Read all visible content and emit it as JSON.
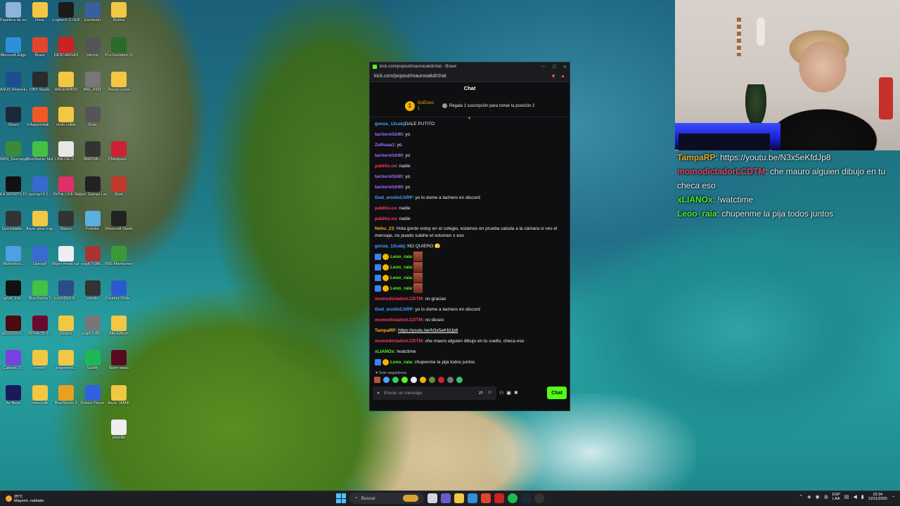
{
  "desktop_icons": [
    {
      "label": "Papelera de reciclaje",
      "color": "#8fb3d9",
      "col": 0,
      "row": 0
    },
    {
      "label": "Drive",
      "color": "#f2c744",
      "col": 1,
      "row": 0
    },
    {
      "label": "Logitech G HUB",
      "color": "#1a1a1a",
      "col": 2,
      "row": 0
    },
    {
      "label": "Escritorio",
      "color": "#3a5fa0",
      "col": 3,
      "row": 0
    },
    {
      "label": "Roblox",
      "color": "#f2c744",
      "col": 4,
      "row": 0
    },
    {
      "label": "Microsoft Edge",
      "color": "#2f8fd8",
      "col": 0,
      "row": 1
    },
    {
      "label": "Brave",
      "color": "#e2452c",
      "col": 1,
      "row": 1
    },
    {
      "label": "DESCARGAS",
      "color": "#cc2222",
      "col": 2,
      "row": 1
    },
    {
      "label": "micros",
      "color": "#555",
      "col": 3,
      "row": 1
    },
    {
      "label": "Pro Evolution Soccer",
      "color": "#2a6a2a",
      "col": 4,
      "row": 1
    },
    {
      "label": "ASUS DriverHub",
      "color": "#1c4f90",
      "col": 0,
      "row": 2
    },
    {
      "label": "OBS Studio",
      "color": "#2a2a2a",
      "col": 1,
      "row": 2
    },
    {
      "label": "ARGENMOD",
      "color": "#f2c744",
      "col": 2,
      "row": 2
    },
    {
      "label": "IMG_8432",
      "color": "#777",
      "col": 3,
      "row": 2
    },
    {
      "label": "Pesos Locos",
      "color": "#f2c744",
      "col": 4,
      "row": 2
    },
    {
      "label": "Steam",
      "color": "#1b2838",
      "col": 0,
      "row": 3
    },
    {
      "label": "EAappinstall...",
      "color": "#f05a22",
      "col": 1,
      "row": 3
    },
    {
      "label": "mofo cuttits",
      "color": "#f2c744",
      "col": 2,
      "row": 3
    },
    {
      "label": "Rust",
      "color": "#555",
      "col": 3,
      "row": 3
    },
    {
      "label": "5809_Descarga",
      "color": "#3a8a3a",
      "col": 0,
      "row": 4
    },
    {
      "label": "BlueStacks Multi-Insta...",
      "color": "#44c044",
      "col": 1,
      "row": 4
    },
    {
      "label": "LINK-DE-D...",
      "color": "#e8e8e8",
      "col": 2,
      "row": 4
    },
    {
      "label": "INNOVA...",
      "color": "#333",
      "col": 3,
      "row": 4
    },
    {
      "label": "CModpack...",
      "color": "#c23",
      "col": 4,
      "row": 4
    },
    {
      "label": "EA SPORTS FC 25",
      "color": "#111",
      "col": 0,
      "row": 5
    },
    {
      "label": "upscayl-2.1...",
      "color": "#3a6ad0",
      "col": 1,
      "row": 5
    },
    {
      "label": "TikTok LIVE Studio",
      "color": "#e0306a",
      "col": 2,
      "row": 5
    },
    {
      "label": "Epic Games Launcher",
      "color": "#222",
      "col": 3,
      "row": 5
    },
    {
      "label": "Rust",
      "color": "#c0392b",
      "col": 4,
      "row": 5
    },
    {
      "label": "EpicInstalle...",
      "color": "#333",
      "col": 0,
      "row": 6
    },
    {
      "label": "flayer para miguel",
      "color": "#f2c744",
      "col": 1,
      "row": 6
    },
    {
      "label": "Banco",
      "color": "#333",
      "col": 2,
      "row": 6
    },
    {
      "label": "Fortnite",
      "color": "#5ab0e0",
      "col": 3,
      "row": 6
    },
    {
      "label": "Minecraft Studio",
      "color": "#222",
      "col": 4,
      "row": 6
    },
    {
      "label": "MisterHors...",
      "color": "#4fa0e0",
      "col": 0,
      "row": 7
    },
    {
      "label": "Upscayl",
      "color": "#3a6ad0",
      "col": 1,
      "row": 7
    },
    {
      "label": "flayer modo carrera",
      "color": "#eee",
      "col": 2,
      "row": 7
    },
    {
      "label": "ezgif-7c9fd...",
      "color": "#a33",
      "col": 3,
      "row": 7
    },
    {
      "label": "MSI Afterburner",
      "color": "#3a9a3a",
      "col": 4,
      "row": 7
    },
    {
      "label": "lghub_inst...",
      "color": "#111",
      "col": 0,
      "row": 8
    },
    {
      "label": "BlueStacks 5",
      "color": "#44c044",
      "col": 1,
      "row": 8
    },
    {
      "label": "bcb2d2e5-8...",
      "color": "#2d4a8a",
      "col": 2,
      "row": 8
    },
    {
      "label": "emote",
      "color": "#333",
      "col": 3,
      "row": 8
    },
    {
      "label": "Counter-Strike 2",
      "color": "#2a5ad0",
      "col": 4,
      "row": 8
    },
    {
      "label": "a6111310-5...",
      "color": "#4a0a10",
      "col": 0,
      "row": 9
    },
    {
      "label": "39704c35-6...",
      "color": "#6a0a30",
      "col": 1,
      "row": 9
    },
    {
      "label": "plugins",
      "color": "#f2c744",
      "col": 2,
      "row": 9
    },
    {
      "label": "ezgif-7c85...",
      "color": "#777",
      "col": 3,
      "row": 9
    },
    {
      "label": "AfterEffects",
      "color": "#f2c744",
      "col": 4,
      "row": 9
    },
    {
      "label": "Capture_2...",
      "color": "#7a40e0",
      "col": 0,
      "row": 10
    },
    {
      "label": "remini",
      "color": "#f2c744",
      "col": 1,
      "row": 10
    },
    {
      "label": "argenmod...",
      "color": "#f2c744",
      "col": 2,
      "row": 10
    },
    {
      "label": "Spotify",
      "color": "#1db954",
      "col": 3,
      "row": 10
    },
    {
      "label": "flayer wepa",
      "color": "#5a0a20",
      "col": 4,
      "row": 10
    },
    {
      "label": "Ae flayer",
      "color": "#1a1a5a",
      "col": 0,
      "row": 11
    },
    {
      "label": "minecraft",
      "color": "#f2c744",
      "col": 1,
      "row": 11
    },
    {
      "label": "BlueStacks X",
      "color": "#e8a020",
      "col": 2,
      "row": 11
    },
    {
      "label": "Roblox Player",
      "color": "#3060e0",
      "col": 3,
      "row": 11
    },
    {
      "label": "flayer JAMIE",
      "color": "#f2c744",
      "col": 4,
      "row": 11
    },
    {
      "label": "plantilla",
      "color": "#eee",
      "col": 4,
      "row": 12
    }
  ],
  "window": {
    "title": "kick.com/popout/maurooakd/chat - Brave",
    "url": "kick.com/popout/maurooakd/chat",
    "header": "Chat",
    "controls": [
      "—",
      "☐",
      "✕"
    ]
  },
  "pinned": {
    "rank": "1",
    "username": "GsEnzo",
    "sub_count": "1",
    "gift_text": "Regala 1 suscripción para tomar la posición 2"
  },
  "messages": [
    {
      "user": "gonza_12cabj",
      "color": "#4aa3ff",
      "text": "DALE PUTITO",
      "badges": []
    },
    {
      "user": "tacherofzk90",
      "color": "#a56cff",
      "text": ": yo",
      "badges": []
    },
    {
      "user": "Zethaaa1",
      "color": "#a56cff",
      "text": ": yo",
      "badges": []
    },
    {
      "user": "tacherofzk90",
      "color": "#a56cff",
      "text": ": yo",
      "badges": []
    },
    {
      "user": "pablito.oo",
      "color": "#ff3b5c",
      "text": ": nadie",
      "badges": []
    },
    {
      "user": "tacherofzk90",
      "color": "#a56cff",
      "text": ": yo",
      "badges": []
    },
    {
      "user": "tacherofzk90",
      "color": "#a56cff",
      "text": ": yo",
      "badges": []
    },
    {
      "user": "God_enzitoCARP",
      "color": "#4aa3ff",
      "text": ": yo lo dome a tachero en discord",
      "badges": []
    },
    {
      "user": "pablito.oo",
      "color": "#ff3b5c",
      "text": ": nadie",
      "badges": []
    },
    {
      "user": "pablito.oo",
      "color": "#ff3b5c",
      "text": ": nadie",
      "badges": []
    },
    {
      "user": "Nehu_23",
      "color": "#ffb020",
      "text": ": Hola gordo estoy en el colegio, estamos en prueba saluda a la cámara si ves el mensaje, no puedo subirle el volumen x eso",
      "badges": [],
      "wrap": true
    },
    {
      "user": "gonza_12cabj",
      "color": "#4aa3ff",
      "text": ": NO QUIERO 🫣",
      "badges": []
    },
    {
      "user": "Leoo_raia",
      "color": "#53fc18",
      "text": ":",
      "badges": [
        "mod",
        "sub"
      ],
      "emote": true
    },
    {
      "user": "Leoo_raia",
      "color": "#53fc18",
      "text": ":",
      "badges": [
        "mod",
        "sub"
      ],
      "emote": true
    },
    {
      "user": "Leoo_raia",
      "color": "#53fc18",
      "text": ":",
      "badges": [
        "mod",
        "sub"
      ],
      "emote": true
    },
    {
      "user": "Leoo_raia",
      "color": "#53fc18",
      "text": ":",
      "badges": [
        "mod",
        "sub"
      ],
      "emote": true
    },
    {
      "user": "momodictadorLCDTM",
      "color": "#ff3b5c",
      "text": ": no gracias",
      "badges": []
    },
    {
      "user": "God_enzitoCARP",
      "color": "#4aa3ff",
      "text": ": yo lo dome a tachero en discord",
      "badges": []
    },
    {
      "user": "momodictadorLCDTM",
      "color": "#ff3b5c",
      "text": ": no deseo",
      "badges": []
    },
    {
      "user": "TampaRP",
      "color": "#ffb020",
      "text": ": ",
      "link": "https://youtu.be/N3x5eKfdJp8",
      "badges": []
    },
    {
      "user": "momodictadorLCDTM",
      "color": "#ff3b5c",
      "text": ": che mauro alguien dibujo en tu cuello, checa eso",
      "badges": []
    },
    {
      "user": "xLIANOx",
      "color": "#53fc18",
      "text": ": !watctime",
      "badges": []
    },
    {
      "user": "Leoo_raia",
      "color": "#53fc18",
      "text": ": chupenme la pija todos juntos",
      "badges": [
        "mod",
        "sub"
      ]
    }
  ],
  "chat_footer": {
    "followers_only": "Solo seguidores",
    "placeholder": "Enviar un mensaje",
    "send_label": "Chat"
  },
  "overlay": [
    {
      "user": "TampaRP",
      "color": "#ffb020",
      "text": ": https://youtu.be/N3x5eKfdJp8"
    },
    {
      "user": "momodictadorLCDTM",
      "color": "#ff3b5c",
      "text": ": che mauro alguien dibujo en tu"
    },
    {
      "user": "",
      "color": "#ffffff",
      "text": "checa eso"
    },
    {
      "user": "xLIANOx",
      "color": "#53fc18",
      "text": ": !watctime"
    },
    {
      "user": "Leoo_raia",
      "color": "#53fc18",
      "text": ": chupenme la pija todos juntos"
    }
  ],
  "taskbar": {
    "temp": "25°C",
    "weather": "Mayorm. nublado",
    "search_placeholder": "Buscar",
    "lang": "ESP",
    "layout": "LAA",
    "time": "15:34",
    "date": "12/11/2025"
  }
}
